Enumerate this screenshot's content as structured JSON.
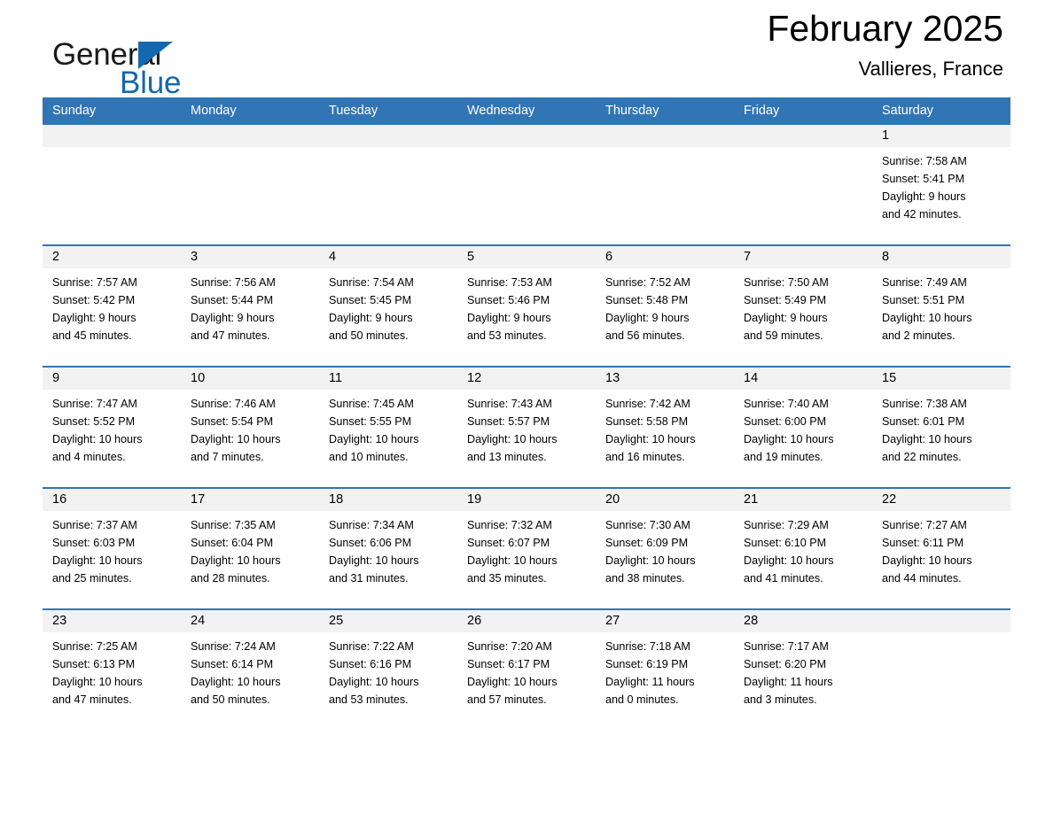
{
  "brand": {
    "name_part1": "General",
    "name_part2": "Blue",
    "triangle_color": "#1368b0",
    "text_color": "#1a1a1a"
  },
  "header": {
    "title": "February 2025",
    "subtitle": "Vallieres, France"
  },
  "theme": {
    "header_blue": "#3275b4",
    "day_band_gray": "#f2f2f2",
    "text": "#000000"
  },
  "weekday_headers": [
    "Sunday",
    "Monday",
    "Tuesday",
    "Wednesday",
    "Thursday",
    "Friday",
    "Saturday"
  ],
  "weeks": [
    [
      {
        "day": "",
        "sunrise": "",
        "sunset": "",
        "daylight_line1": "",
        "daylight_line2": ""
      },
      {
        "day": "",
        "sunrise": "",
        "sunset": "",
        "daylight_line1": "",
        "daylight_line2": ""
      },
      {
        "day": "",
        "sunrise": "",
        "sunset": "",
        "daylight_line1": "",
        "daylight_line2": ""
      },
      {
        "day": "",
        "sunrise": "",
        "sunset": "",
        "daylight_line1": "",
        "daylight_line2": ""
      },
      {
        "day": "",
        "sunrise": "",
        "sunset": "",
        "daylight_line1": "",
        "daylight_line2": ""
      },
      {
        "day": "",
        "sunrise": "",
        "sunset": "",
        "daylight_line1": "",
        "daylight_line2": ""
      },
      {
        "day": "1",
        "sunrise": "Sunrise: 7:58 AM",
        "sunset": "Sunset: 5:41 PM",
        "daylight_line1": "Daylight: 9 hours",
        "daylight_line2": "and 42 minutes."
      }
    ],
    [
      {
        "day": "2",
        "sunrise": "Sunrise: 7:57 AM",
        "sunset": "Sunset: 5:42 PM",
        "daylight_line1": "Daylight: 9 hours",
        "daylight_line2": "and 45 minutes."
      },
      {
        "day": "3",
        "sunrise": "Sunrise: 7:56 AM",
        "sunset": "Sunset: 5:44 PM",
        "daylight_line1": "Daylight: 9 hours",
        "daylight_line2": "and 47 minutes."
      },
      {
        "day": "4",
        "sunrise": "Sunrise: 7:54 AM",
        "sunset": "Sunset: 5:45 PM",
        "daylight_line1": "Daylight: 9 hours",
        "daylight_line2": "and 50 minutes."
      },
      {
        "day": "5",
        "sunrise": "Sunrise: 7:53 AM",
        "sunset": "Sunset: 5:46 PM",
        "daylight_line1": "Daylight: 9 hours",
        "daylight_line2": "and 53 minutes."
      },
      {
        "day": "6",
        "sunrise": "Sunrise: 7:52 AM",
        "sunset": "Sunset: 5:48 PM",
        "daylight_line1": "Daylight: 9 hours",
        "daylight_line2": "and 56 minutes."
      },
      {
        "day": "7",
        "sunrise": "Sunrise: 7:50 AM",
        "sunset": "Sunset: 5:49 PM",
        "daylight_line1": "Daylight: 9 hours",
        "daylight_line2": "and 59 minutes."
      },
      {
        "day": "8",
        "sunrise": "Sunrise: 7:49 AM",
        "sunset": "Sunset: 5:51 PM",
        "daylight_line1": "Daylight: 10 hours",
        "daylight_line2": "and 2 minutes."
      }
    ],
    [
      {
        "day": "9",
        "sunrise": "Sunrise: 7:47 AM",
        "sunset": "Sunset: 5:52 PM",
        "daylight_line1": "Daylight: 10 hours",
        "daylight_line2": "and 4 minutes."
      },
      {
        "day": "10",
        "sunrise": "Sunrise: 7:46 AM",
        "sunset": "Sunset: 5:54 PM",
        "daylight_line1": "Daylight: 10 hours",
        "daylight_line2": "and 7 minutes."
      },
      {
        "day": "11",
        "sunrise": "Sunrise: 7:45 AM",
        "sunset": "Sunset: 5:55 PM",
        "daylight_line1": "Daylight: 10 hours",
        "daylight_line2": "and 10 minutes."
      },
      {
        "day": "12",
        "sunrise": "Sunrise: 7:43 AM",
        "sunset": "Sunset: 5:57 PM",
        "daylight_line1": "Daylight: 10 hours",
        "daylight_line2": "and 13 minutes."
      },
      {
        "day": "13",
        "sunrise": "Sunrise: 7:42 AM",
        "sunset": "Sunset: 5:58 PM",
        "daylight_line1": "Daylight: 10 hours",
        "daylight_line2": "and 16 minutes."
      },
      {
        "day": "14",
        "sunrise": "Sunrise: 7:40 AM",
        "sunset": "Sunset: 6:00 PM",
        "daylight_line1": "Daylight: 10 hours",
        "daylight_line2": "and 19 minutes."
      },
      {
        "day": "15",
        "sunrise": "Sunrise: 7:38 AM",
        "sunset": "Sunset: 6:01 PM",
        "daylight_line1": "Daylight: 10 hours",
        "daylight_line2": "and 22 minutes."
      }
    ],
    [
      {
        "day": "16",
        "sunrise": "Sunrise: 7:37 AM",
        "sunset": "Sunset: 6:03 PM",
        "daylight_line1": "Daylight: 10 hours",
        "daylight_line2": "and 25 minutes."
      },
      {
        "day": "17",
        "sunrise": "Sunrise: 7:35 AM",
        "sunset": "Sunset: 6:04 PM",
        "daylight_line1": "Daylight: 10 hours",
        "daylight_line2": "and 28 minutes."
      },
      {
        "day": "18",
        "sunrise": "Sunrise: 7:34 AM",
        "sunset": "Sunset: 6:06 PM",
        "daylight_line1": "Daylight: 10 hours",
        "daylight_line2": "and 31 minutes."
      },
      {
        "day": "19",
        "sunrise": "Sunrise: 7:32 AM",
        "sunset": "Sunset: 6:07 PM",
        "daylight_line1": "Daylight: 10 hours",
        "daylight_line2": "and 35 minutes."
      },
      {
        "day": "20",
        "sunrise": "Sunrise: 7:30 AM",
        "sunset": "Sunset: 6:09 PM",
        "daylight_line1": "Daylight: 10 hours",
        "daylight_line2": "and 38 minutes."
      },
      {
        "day": "21",
        "sunrise": "Sunrise: 7:29 AM",
        "sunset": "Sunset: 6:10 PM",
        "daylight_line1": "Daylight: 10 hours",
        "daylight_line2": "and 41 minutes."
      },
      {
        "day": "22",
        "sunrise": "Sunrise: 7:27 AM",
        "sunset": "Sunset: 6:11 PM",
        "daylight_line1": "Daylight: 10 hours",
        "daylight_line2": "and 44 minutes."
      }
    ],
    [
      {
        "day": "23",
        "sunrise": "Sunrise: 7:25 AM",
        "sunset": "Sunset: 6:13 PM",
        "daylight_line1": "Daylight: 10 hours",
        "daylight_line2": "and 47 minutes."
      },
      {
        "day": "24",
        "sunrise": "Sunrise: 7:24 AM",
        "sunset": "Sunset: 6:14 PM",
        "daylight_line1": "Daylight: 10 hours",
        "daylight_line2": "and 50 minutes."
      },
      {
        "day": "25",
        "sunrise": "Sunrise: 7:22 AM",
        "sunset": "Sunset: 6:16 PM",
        "daylight_line1": "Daylight: 10 hours",
        "daylight_line2": "and 53 minutes."
      },
      {
        "day": "26",
        "sunrise": "Sunrise: 7:20 AM",
        "sunset": "Sunset: 6:17 PM",
        "daylight_line1": "Daylight: 10 hours",
        "daylight_line2": "and 57 minutes."
      },
      {
        "day": "27",
        "sunrise": "Sunrise: 7:18 AM",
        "sunset": "Sunset: 6:19 PM",
        "daylight_line1": "Daylight: 11 hours",
        "daylight_line2": "and 0 minutes."
      },
      {
        "day": "28",
        "sunrise": "Sunrise: 7:17 AM",
        "sunset": "Sunset: 6:20 PM",
        "daylight_line1": "Daylight: 11 hours",
        "daylight_line2": "and 3 minutes."
      },
      {
        "day": "",
        "sunrise": "",
        "sunset": "",
        "daylight_line1": "",
        "daylight_line2": ""
      }
    ]
  ]
}
